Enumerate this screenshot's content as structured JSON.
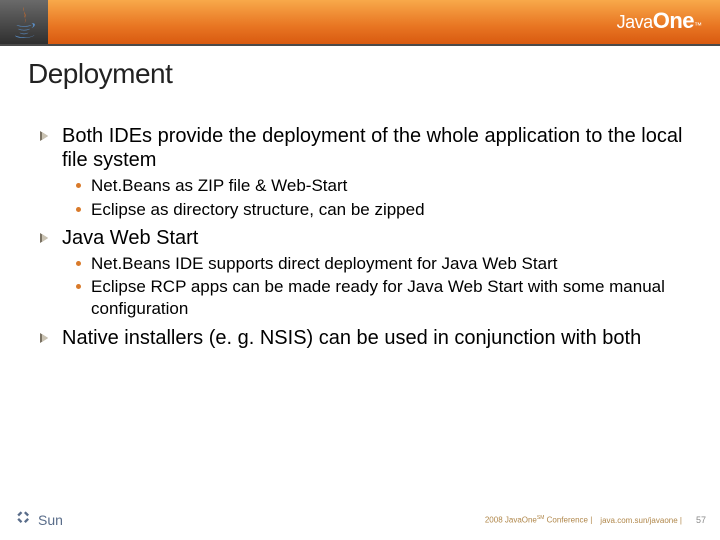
{
  "header": {
    "javaone_prefix": "Java",
    "javaone_suffix": "One"
  },
  "title": "Deployment",
  "bullets": {
    "b1": "Both IDEs provide the deployment of the whole application to the local file system",
    "b1a": "Net.Beans as ZIP file & Web-Start",
    "b1b": "Eclipse as directory structure, can be zipped",
    "b2": "Java Web Start",
    "b2a": "Net.Beans IDE supports direct deployment for Java Web Start",
    "b2b": "Eclipse RCP apps can be made ready for Java Web Start with some manual configuration",
    "b3": "Native installers (e. g. NSIS) can be used in conjunction with both"
  },
  "footer": {
    "sun": "Sun",
    "conf": "2008 JavaOne",
    "conf_suffix": "Conference |",
    "url": "java.com.sun/javaone |",
    "page": "57",
    "sm": "SM"
  }
}
